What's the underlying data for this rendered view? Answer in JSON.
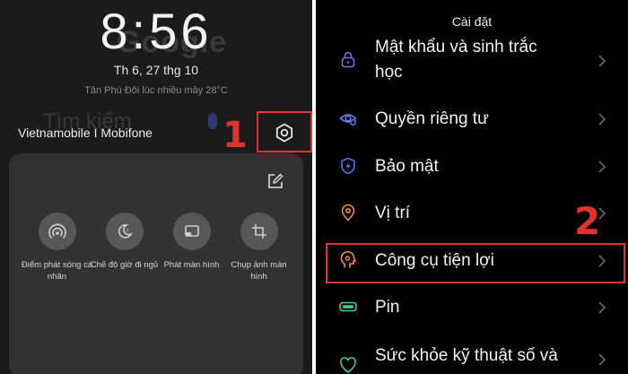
{
  "left": {
    "ghost_google": "Google",
    "clock": "8:56",
    "date": "Th 6, 27 thg 10",
    "weather": "Tân Phú Đôi lúc nhiều mây 28°C",
    "ghost_search": "Tìm kiếm",
    "carrier": "Vietnamobile I Mobifone",
    "step_number": "1",
    "tiles": [
      {
        "label": "Điểm phát sóng cá nhân",
        "icon": "hotspot-icon"
      },
      {
        "label": "Chế độ giờ đi ngủ",
        "icon": "bedtime-icon"
      },
      {
        "label": "Phát màn hình",
        "icon": "cast-icon"
      },
      {
        "label": "Chụp ảnh màn hình",
        "icon": "screenshot-icon"
      }
    ]
  },
  "right": {
    "title": "Cài đặt",
    "step_number": "2",
    "items": [
      {
        "label": "Mật khẩu và sinh trắc học",
        "line1": "Mật khẩu và sinh trắc",
        "line2": "học",
        "icon": "lock-icon",
        "color": "#7b6cf0"
      },
      {
        "label": "Quyền riêng tư",
        "icon": "privacy-icon",
        "color": "#6a7bef"
      },
      {
        "label": "Bảo mật",
        "icon": "shield-icon",
        "color": "#5b6cf5"
      },
      {
        "label": "Vị trí",
        "icon": "location-icon",
        "color": "#f08a4b"
      },
      {
        "label": "Công cụ tiện lợi",
        "icon": "convenience-tools-icon",
        "color": "#f08a4b"
      },
      {
        "label": "Pin",
        "icon": "battery-icon",
        "color": "#3fd08b"
      },
      {
        "label": "Sức khỏe kỹ thuật số và",
        "icon": "digital-wellbeing-icon",
        "color": "#3fd08b"
      }
    ]
  },
  "colors": {
    "annotation": "#e0332b"
  }
}
